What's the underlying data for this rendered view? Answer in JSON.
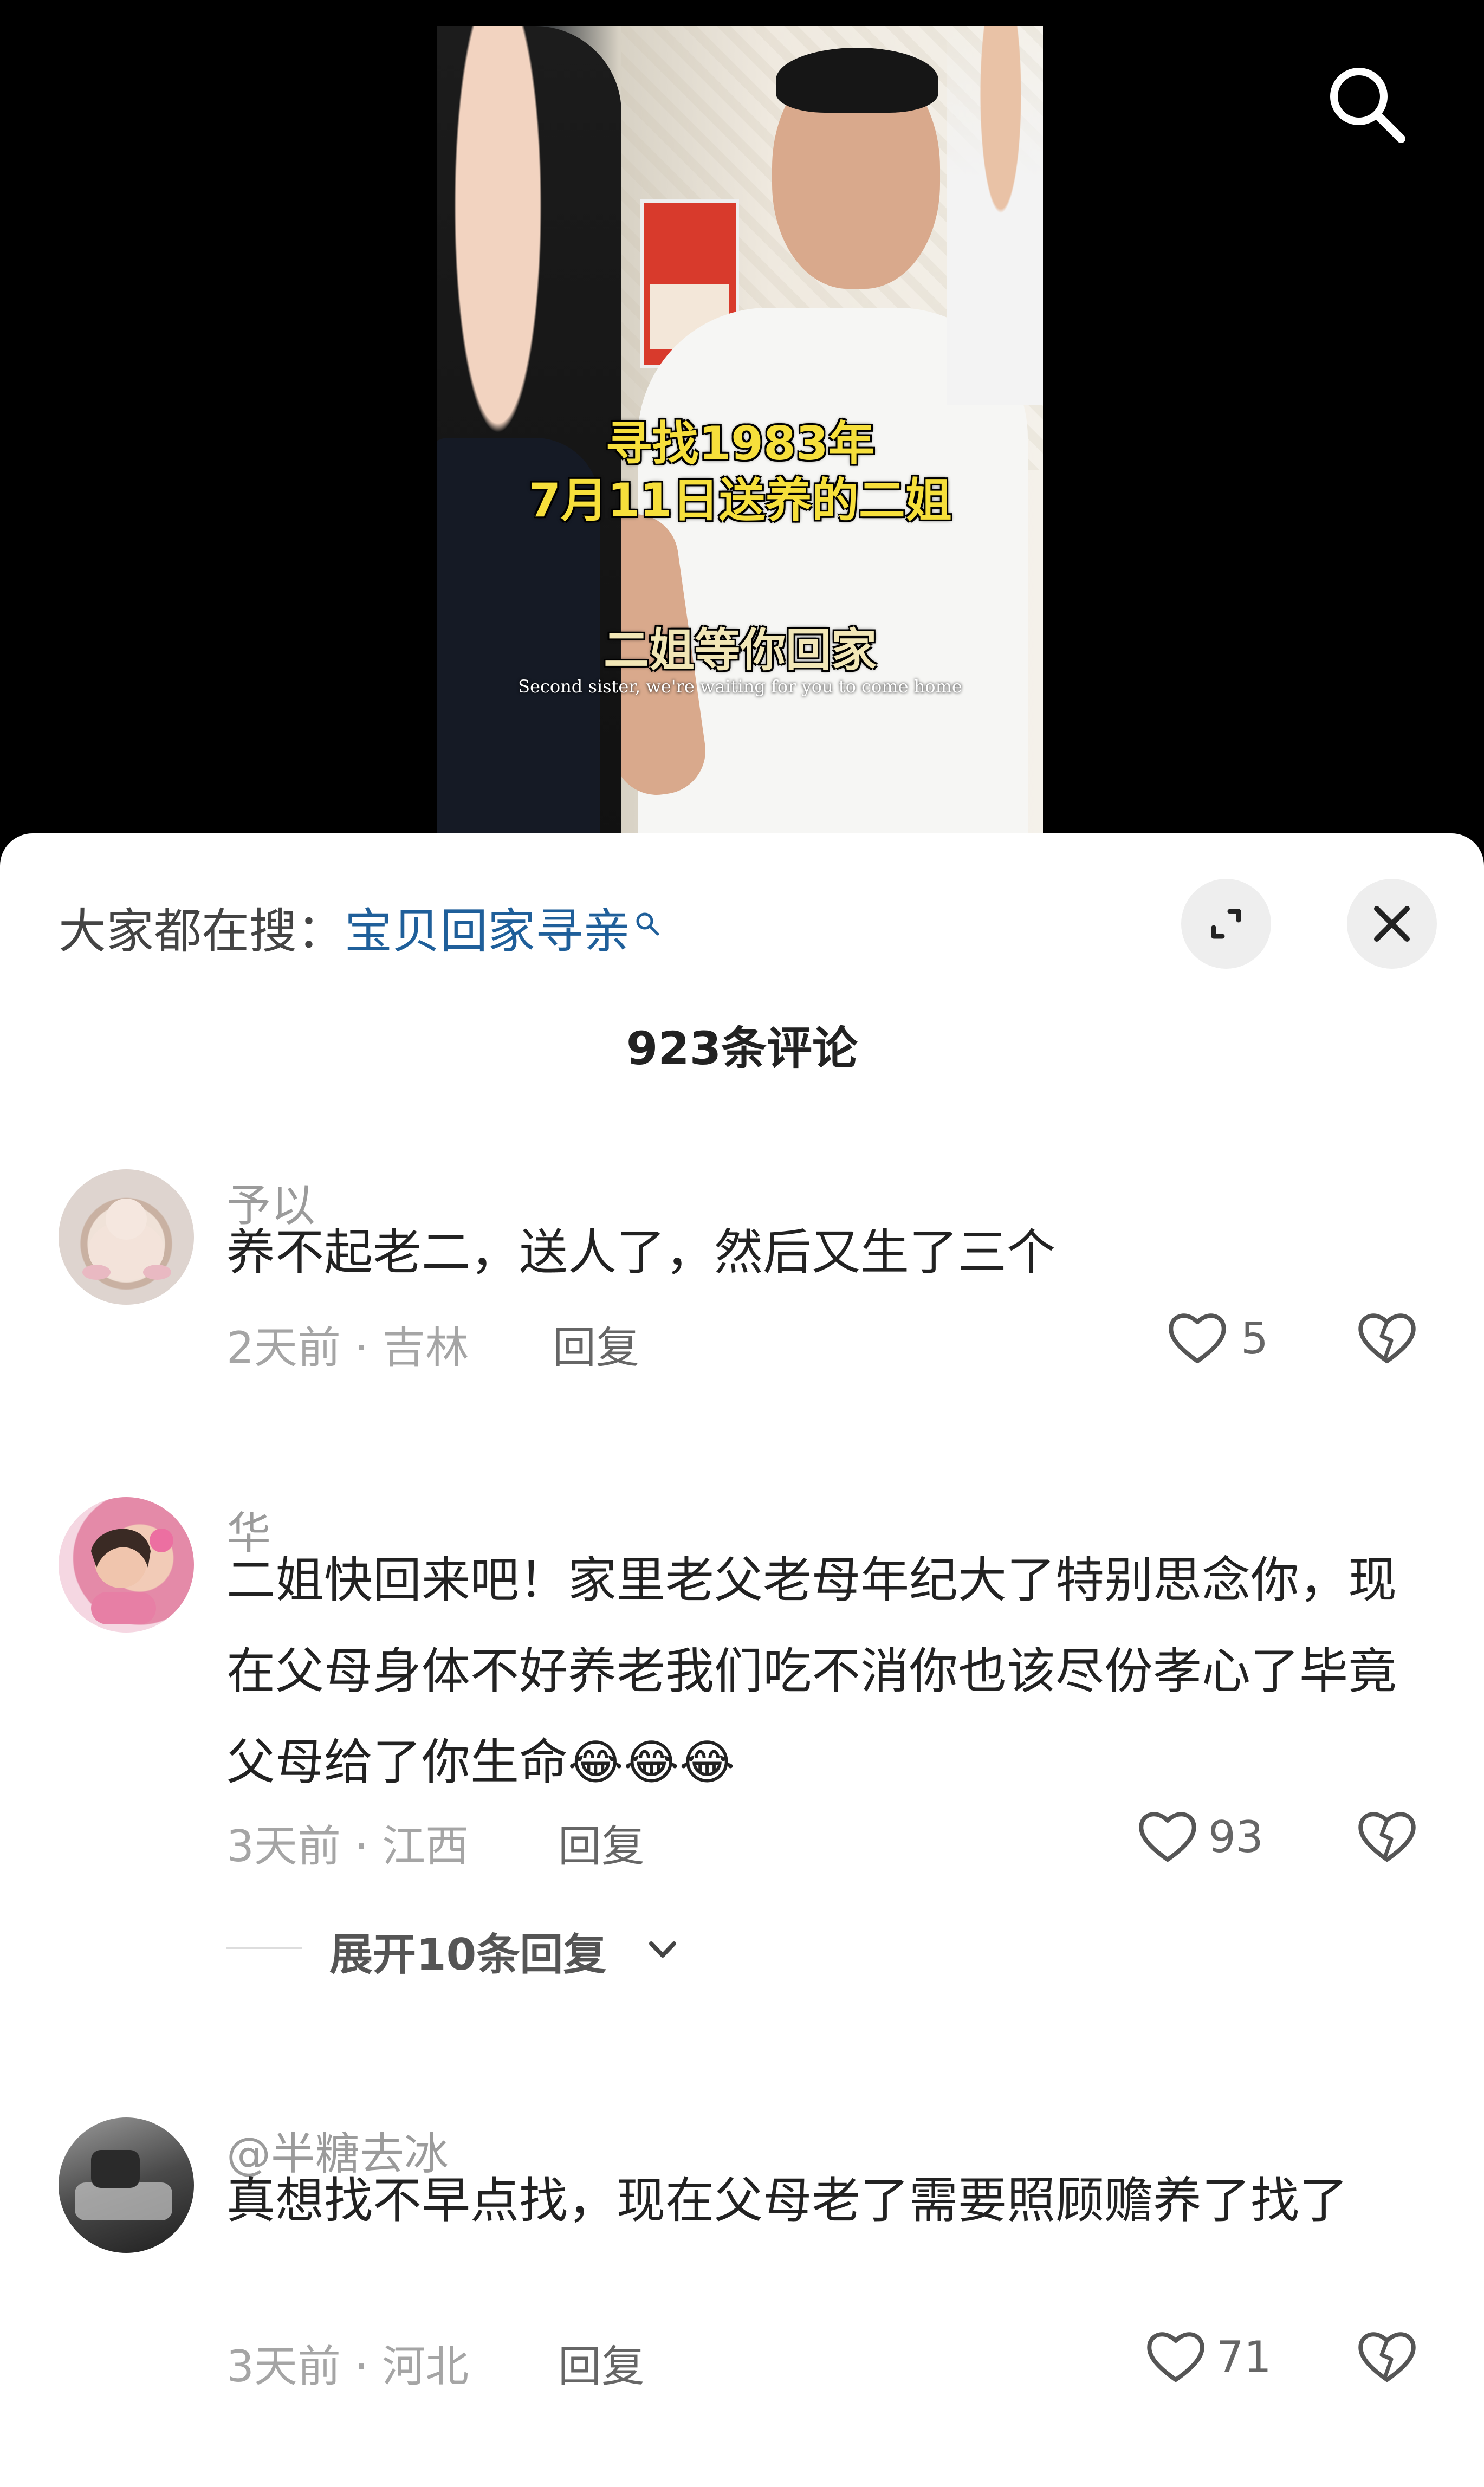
{
  "video": {
    "overlay_title_line1": "寻找1983年",
    "overlay_title_line2": "7月11日送养的二姐",
    "overlay_subtitle": "二姐等你回家",
    "overlay_english": "Second sister, we're waiting for you to come home",
    "search_icon": "search-icon"
  },
  "comments_sheet": {
    "hot_search_label": "大家都在搜：",
    "hot_search_keyword": "宝贝回家寻亲",
    "expand_icon": "expand-icon",
    "close_icon": "close-icon",
    "comment_count": "923条评论",
    "comments": [
      {
        "username": "予以",
        "text": "养不起老二，送人了，然后又生了三个",
        "meta": "2天前 · 吉林",
        "reply_label": "回复",
        "likes": "5",
        "avatar_colors": [
          "#e8d7cf",
          "#c9b7ab"
        ]
      },
      {
        "username": "华",
        "text": "二姐快回来吧！家里老父老母年纪大了特别思念你，现在父母身体不好养老我们吃不消你也该尽份孝心了毕竟父母给了你生命",
        "emojis": "😂😂😂",
        "meta": "3天前 · 江西",
        "reply_label": "回复",
        "likes": "93",
        "expand_replies": "展开10条回复",
        "avatar_colors": [
          "#f3c6d6",
          "#e38aa6"
        ]
      },
      {
        "username": "@半糖去冰",
        "text": "真想找不早点找，现在父母老了需要照顾赡养了找了",
        "meta": "3天前 · 河北",
        "reply_label": "回复",
        "likes": "71",
        "avatar_colors": [
          "#6d6d6d",
          "#2e2e2e"
        ]
      }
    ]
  }
}
